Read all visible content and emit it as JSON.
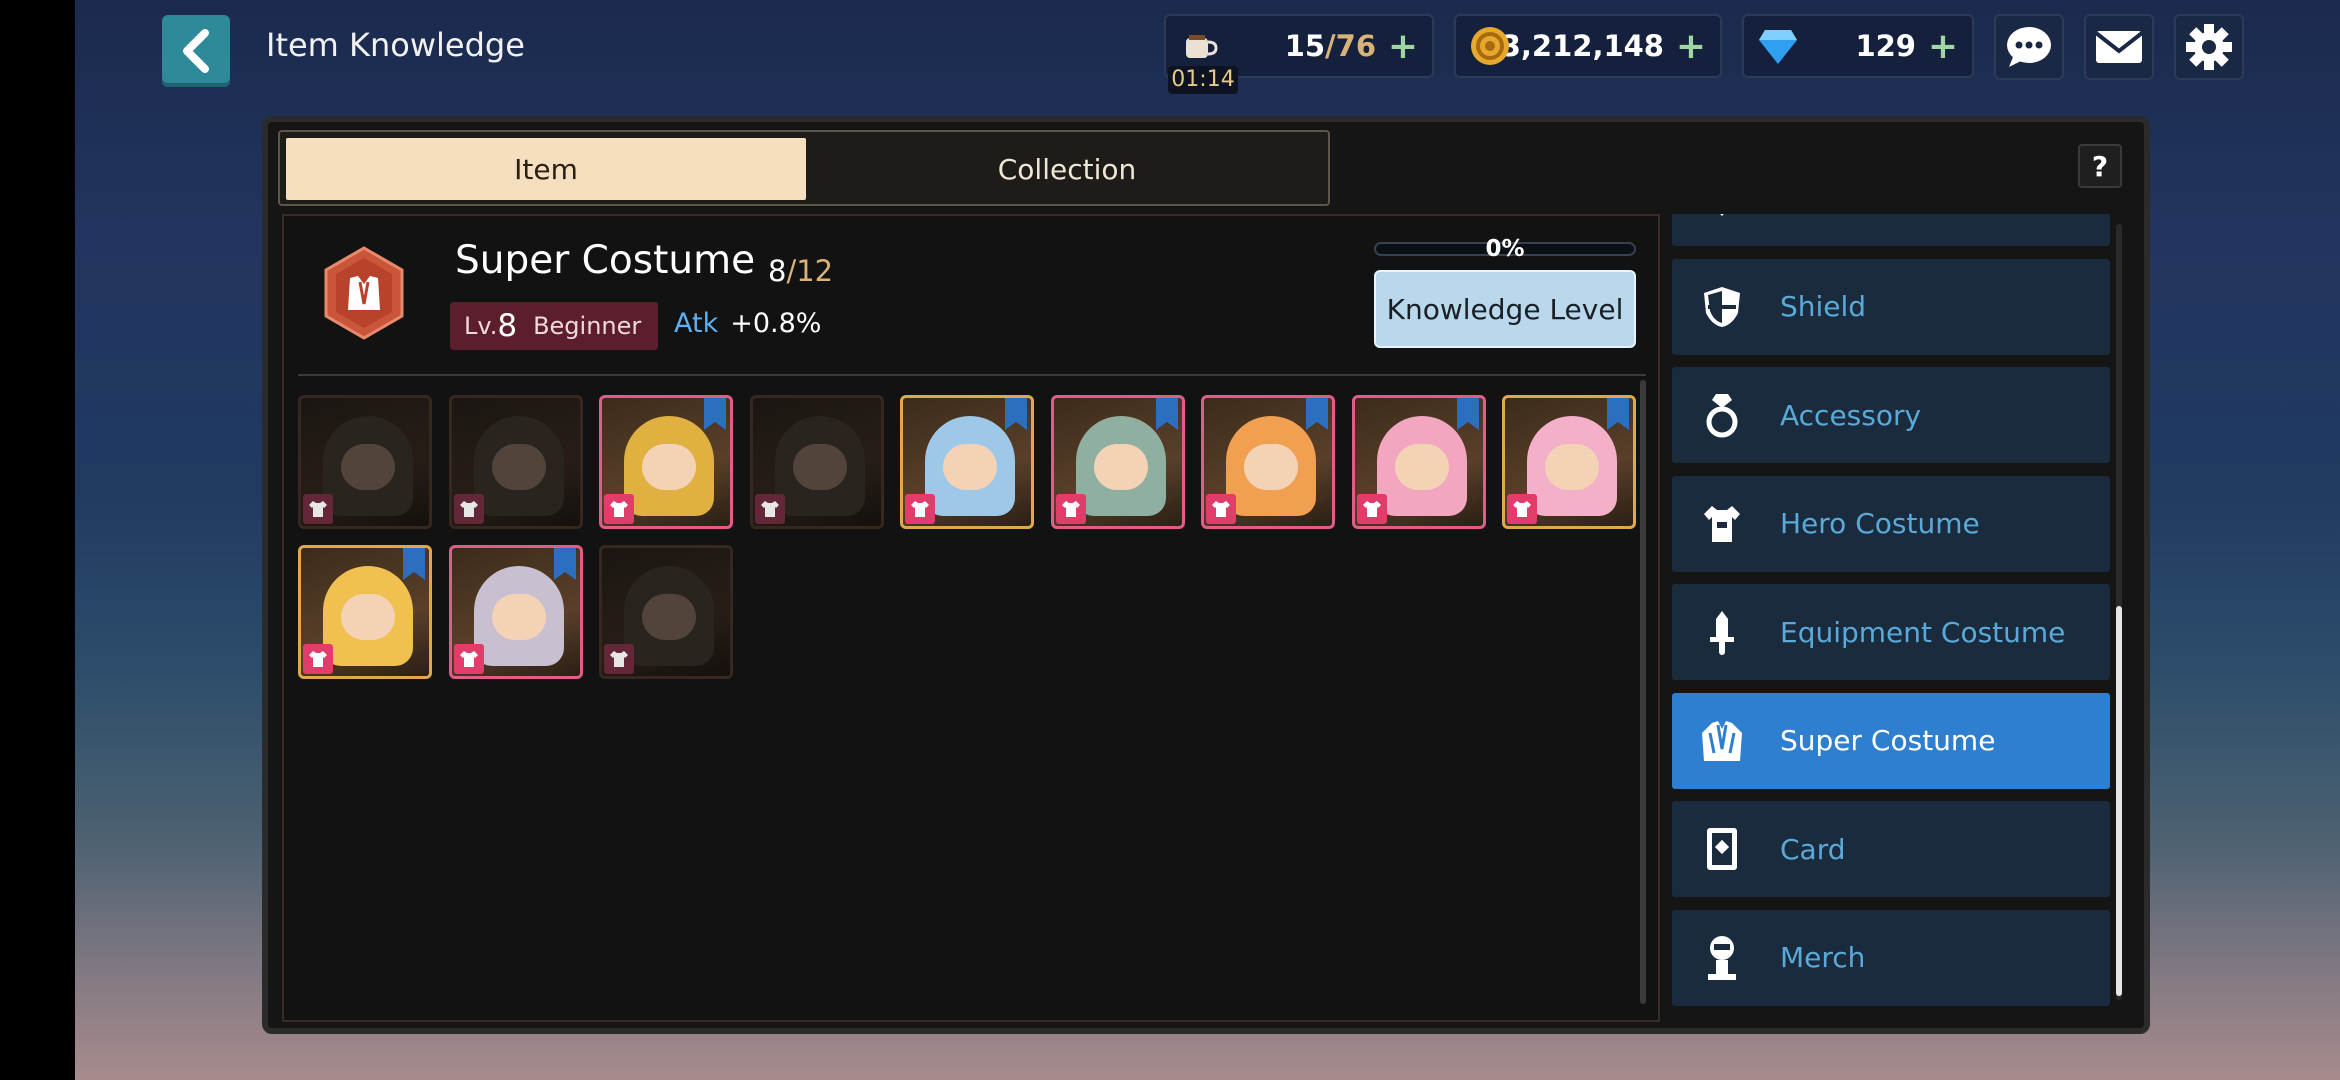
{
  "header": {
    "title": "Item Knowledge",
    "stamina": {
      "current": "15",
      "max": "/76",
      "timer": "01:14"
    },
    "gold": "13,212,148",
    "gems": "129"
  },
  "tabs": {
    "item": "Item",
    "collection": "Collection"
  },
  "help": "?",
  "detail": {
    "name": "Super Costume",
    "count_current": "8",
    "count_total": "/12",
    "level_prefix": "Lv.",
    "level": "8",
    "rank": "Beginner",
    "stat_label": "Atk",
    "stat_value": "+0.8%",
    "progress_percent": 0,
    "progress_text": "0%",
    "knowledge_button": "Knowledge Level"
  },
  "costumes": [
    {
      "owned": false,
      "flag": false
    },
    {
      "owned": false,
      "flag": false
    },
    {
      "owned": true,
      "flag": true
    },
    {
      "owned": false,
      "flag": false
    },
    {
      "owned": true,
      "flag": true
    },
    {
      "owned": true,
      "flag": true
    },
    {
      "owned": true,
      "flag": true
    },
    {
      "owned": true,
      "flag": true
    },
    {
      "owned": true,
      "flag": true
    },
    {
      "owned": true,
      "flag": true
    },
    {
      "owned": true,
      "flag": true
    },
    {
      "owned": false,
      "flag": false
    }
  ],
  "categories": [
    {
      "label": "Claw",
      "icon": "claw-icon"
    },
    {
      "label": "Shield",
      "icon": "shield-icon"
    },
    {
      "label": "Accessory",
      "icon": "ring-icon"
    },
    {
      "label": "Hero Costume",
      "icon": "shirt-icon"
    },
    {
      "label": "Equipment Costume",
      "icon": "sword-icon"
    },
    {
      "label": "Super Costume",
      "icon": "suit-icon",
      "active": true
    },
    {
      "label": "Card",
      "icon": "card-icon"
    },
    {
      "label": "Merch",
      "icon": "merch-icon"
    }
  ],
  "colors": {
    "accent": "#2f7fd0",
    "tab_active": "#f6dfbe",
    "owned_border": "#e25c8a"
  }
}
